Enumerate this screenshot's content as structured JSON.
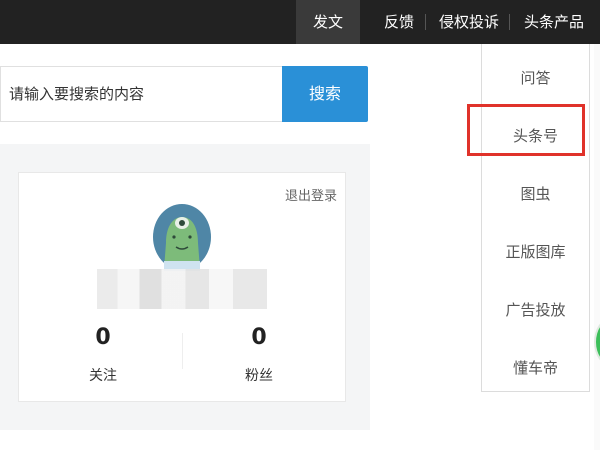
{
  "topnav": {
    "post": "发文",
    "feedback": "反馈",
    "rights": "侵权投诉",
    "products": "头条产品"
  },
  "search": {
    "placeholder": "请输入要搜索的内容",
    "button": "搜索"
  },
  "profile": {
    "logout": "退出登录",
    "follow_count": "0",
    "follow_label": "关注",
    "fans_count": "0",
    "fans_label": "粉丝"
  },
  "products_menu": {
    "items": [
      "问答",
      "头条号",
      "图虫",
      "正版图库",
      "广告投放",
      "懂车帝"
    ],
    "highlighted": "头条号"
  },
  "colors": {
    "topbar": "#222222",
    "accent": "#2a90d7",
    "highlight": "#e0322a"
  }
}
